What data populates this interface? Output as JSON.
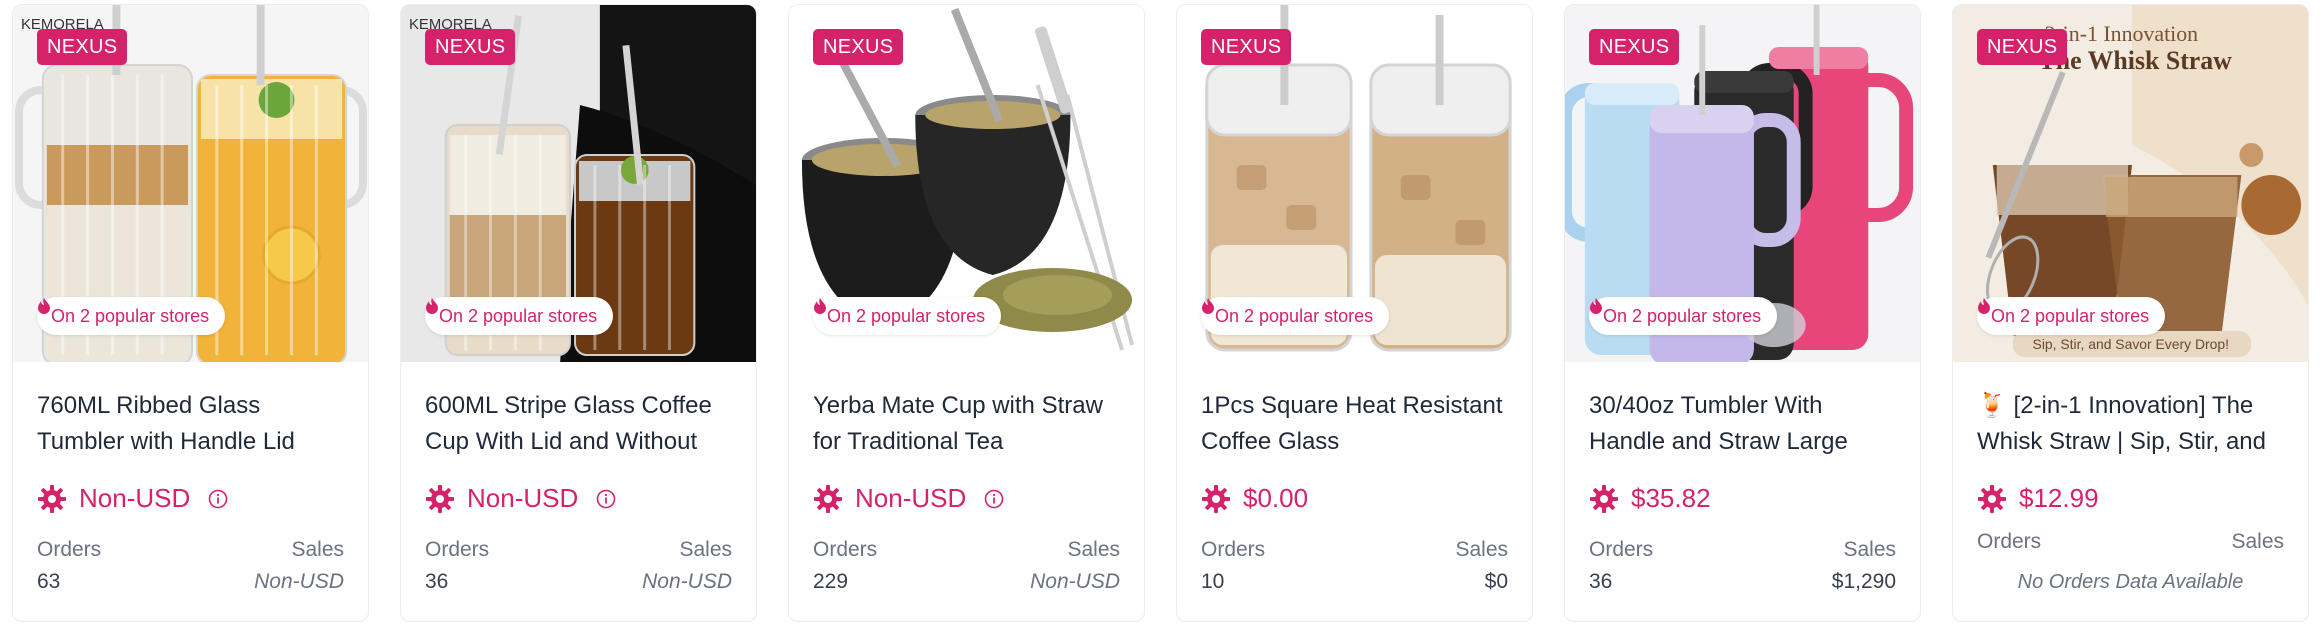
{
  "badge_label": "NEXUS",
  "stores_label": "On 2 popular stores",
  "orders_label": "Orders",
  "sales_label": "Sales",
  "accent_color": "#d6226b",
  "products": [
    {
      "image_brand": "KEMORELA",
      "title": "760ML Ribbed Glass Tumbler with Handle Lid",
      "price": "Non-USD",
      "orders": "63",
      "sales": "Non-USD"
    },
    {
      "image_brand": "KEMORELA",
      "title": "600ML Stripe Glass Coffee Cup With Lid and Without",
      "price": "Non-USD",
      "orders": "36",
      "sales": "Non-USD"
    },
    {
      "title": "Yerba Mate Cup with Straw for Traditional Tea",
      "price": "Non-USD",
      "orders": "229",
      "sales": "Non-USD"
    },
    {
      "title": "1Pcs Square Heat Resistant Coffee Glass",
      "price": "$0.00",
      "orders": "10",
      "sales": "$0"
    },
    {
      "title": "30/40oz Tumbler With Handle and Straw Large",
      "price": "$35.82",
      "orders": "36",
      "sales": "$1,290"
    },
    {
      "image_text_top": "2-in-1 Innovation",
      "image_text_main": "The Whisk Straw",
      "image_text_bottom": "Sip, Stir, and Savor Every Drop!",
      "title": "🍹 [2-in-1 Innovation] The Whisk Straw | Sip, Stir, and",
      "price": "$12.99",
      "no_orders": "No Orders Data Available"
    }
  ]
}
